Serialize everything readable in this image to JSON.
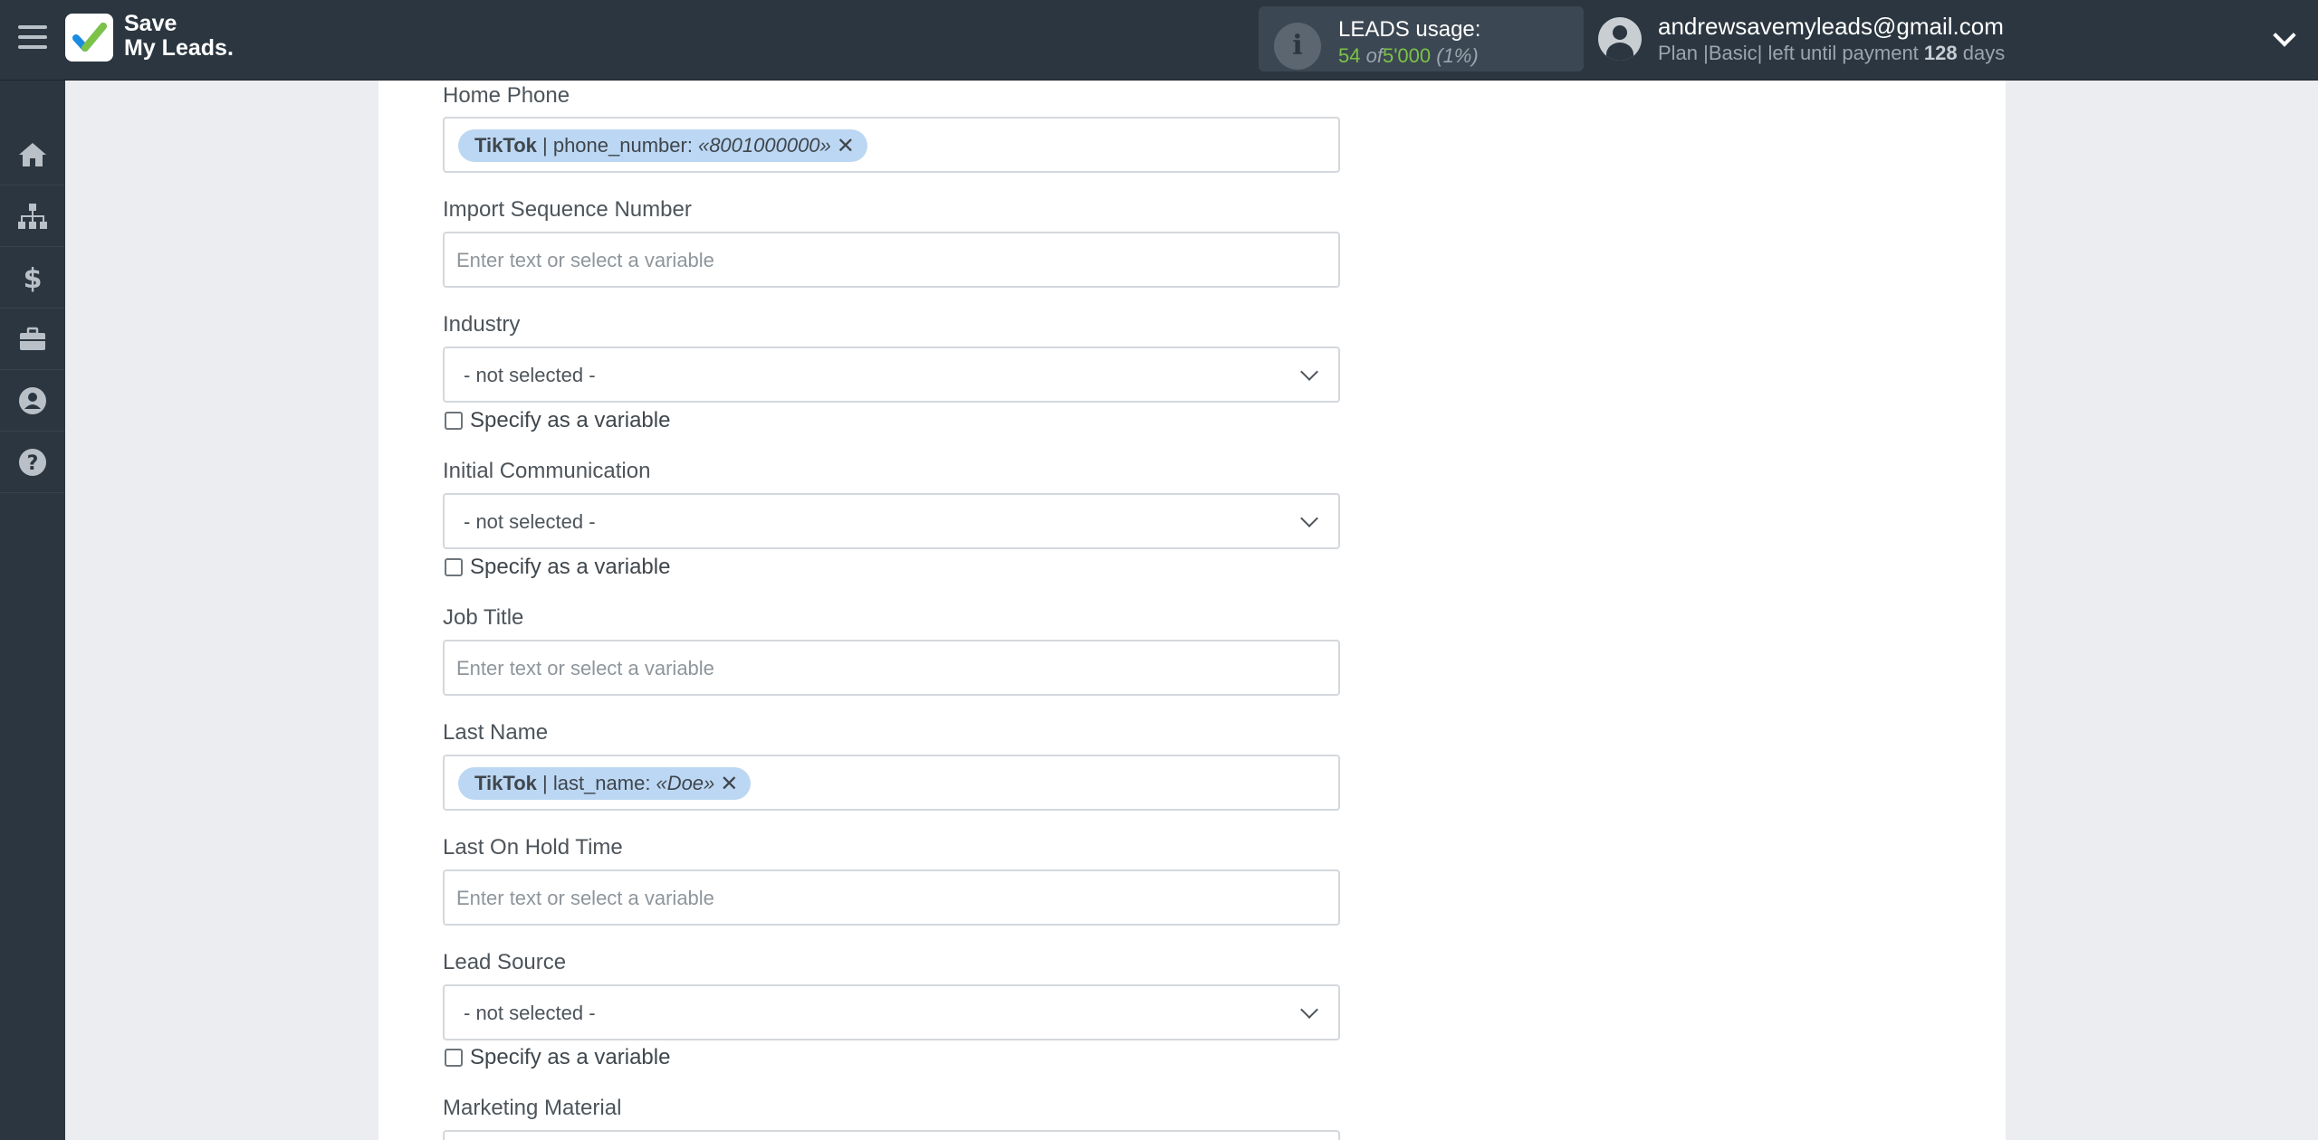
{
  "brand": {
    "line1": "Save",
    "line2": "My Leads",
    "dot": "."
  },
  "usage": {
    "label": "LEADS usage:",
    "used": "54",
    "of": "of",
    "total": "5'000",
    "percent": "(1%)"
  },
  "user": {
    "email": "andrewsavemyleads@gmail.com",
    "plan_prefix": "Plan |Basic| left until payment",
    "days": "128",
    "days_suffix": "days"
  },
  "sidebar": {
    "items": [
      {
        "name": "home-icon"
      },
      {
        "name": "sitemap-icon"
      },
      {
        "name": "dollar-icon"
      },
      {
        "name": "briefcase-icon"
      },
      {
        "name": "user-circle-icon"
      },
      {
        "name": "question-icon"
      }
    ]
  },
  "form": {
    "home_phone": {
      "label": "Home Phone",
      "tag": {
        "source": "TikTok",
        "field": "| phone_number:",
        "value": "«8001000000»",
        "remove": "✕"
      }
    },
    "import_sequence": {
      "label": "Import Sequence Number",
      "placeholder": "Enter text or select a variable"
    },
    "industry": {
      "label": "Industry",
      "value": "- not selected -",
      "checkbox": "Specify as a variable"
    },
    "initial_communication": {
      "label": "Initial Communication",
      "value": "- not selected -",
      "checkbox": "Specify as a variable"
    },
    "job_title": {
      "label": "Job Title",
      "placeholder": "Enter text or select a variable"
    },
    "last_name": {
      "label": "Last Name",
      "tag": {
        "source": "TikTok",
        "field": "| last_name:",
        "value": "«Doe»",
        "remove": "✕"
      }
    },
    "last_on_hold": {
      "label": "Last On Hold Time",
      "placeholder": "Enter text or select a variable"
    },
    "lead_source": {
      "label": "Lead Source",
      "value": "- not selected -",
      "checkbox": "Specify as a variable"
    },
    "marketing_material": {
      "label": "Marketing Material"
    }
  },
  "colors": {
    "topbar": "#2b3640",
    "accent_green": "#7cc247",
    "tag_bg": "#bcd7f3"
  }
}
